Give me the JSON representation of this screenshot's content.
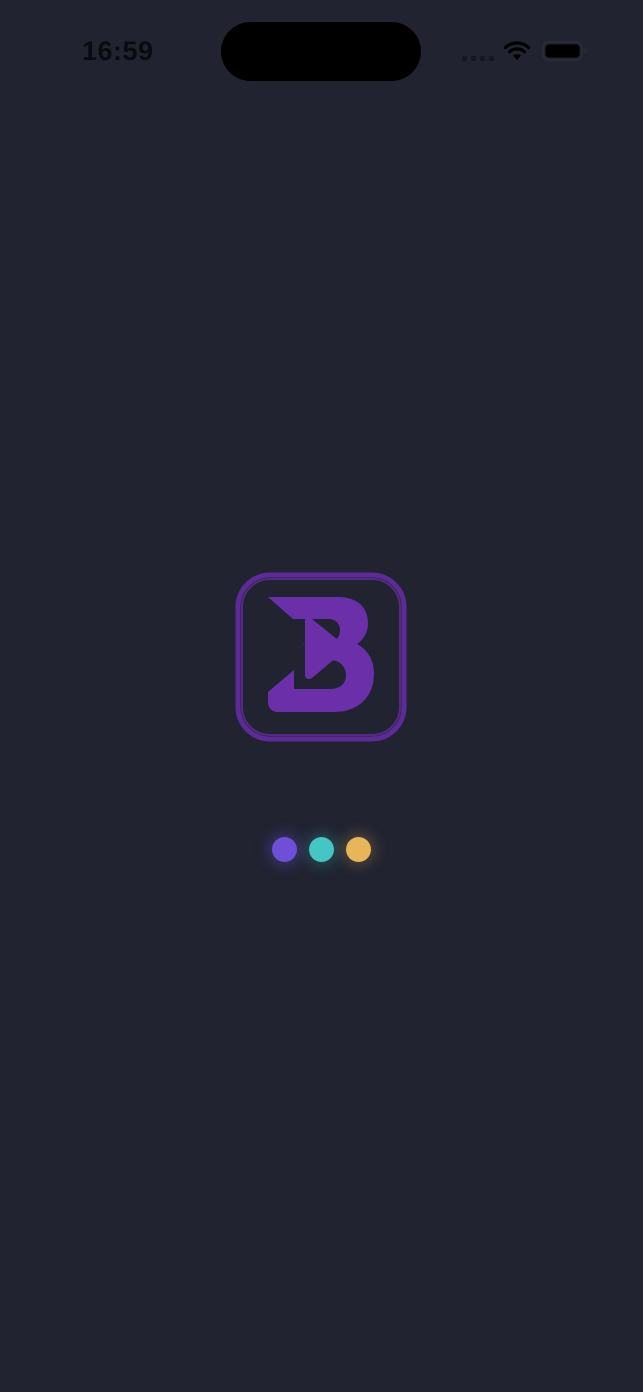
{
  "status_bar": {
    "time": "16:59",
    "icons": [
      "cellular-signal-icon",
      "wifi-icon",
      "battery-icon"
    ]
  },
  "splash": {
    "logo": "app-logo-b-play",
    "loading_indicator": "three-dot-loader"
  },
  "colors": {
    "background": "#212331",
    "logo_purple": "#6a2fa9",
    "logo_border": "#5e2a98",
    "dot_purple": "#6d4fd8",
    "dot_teal": "#45c6c5",
    "dot_yellow": "#e8b558",
    "status_text": "#0a0b10"
  }
}
